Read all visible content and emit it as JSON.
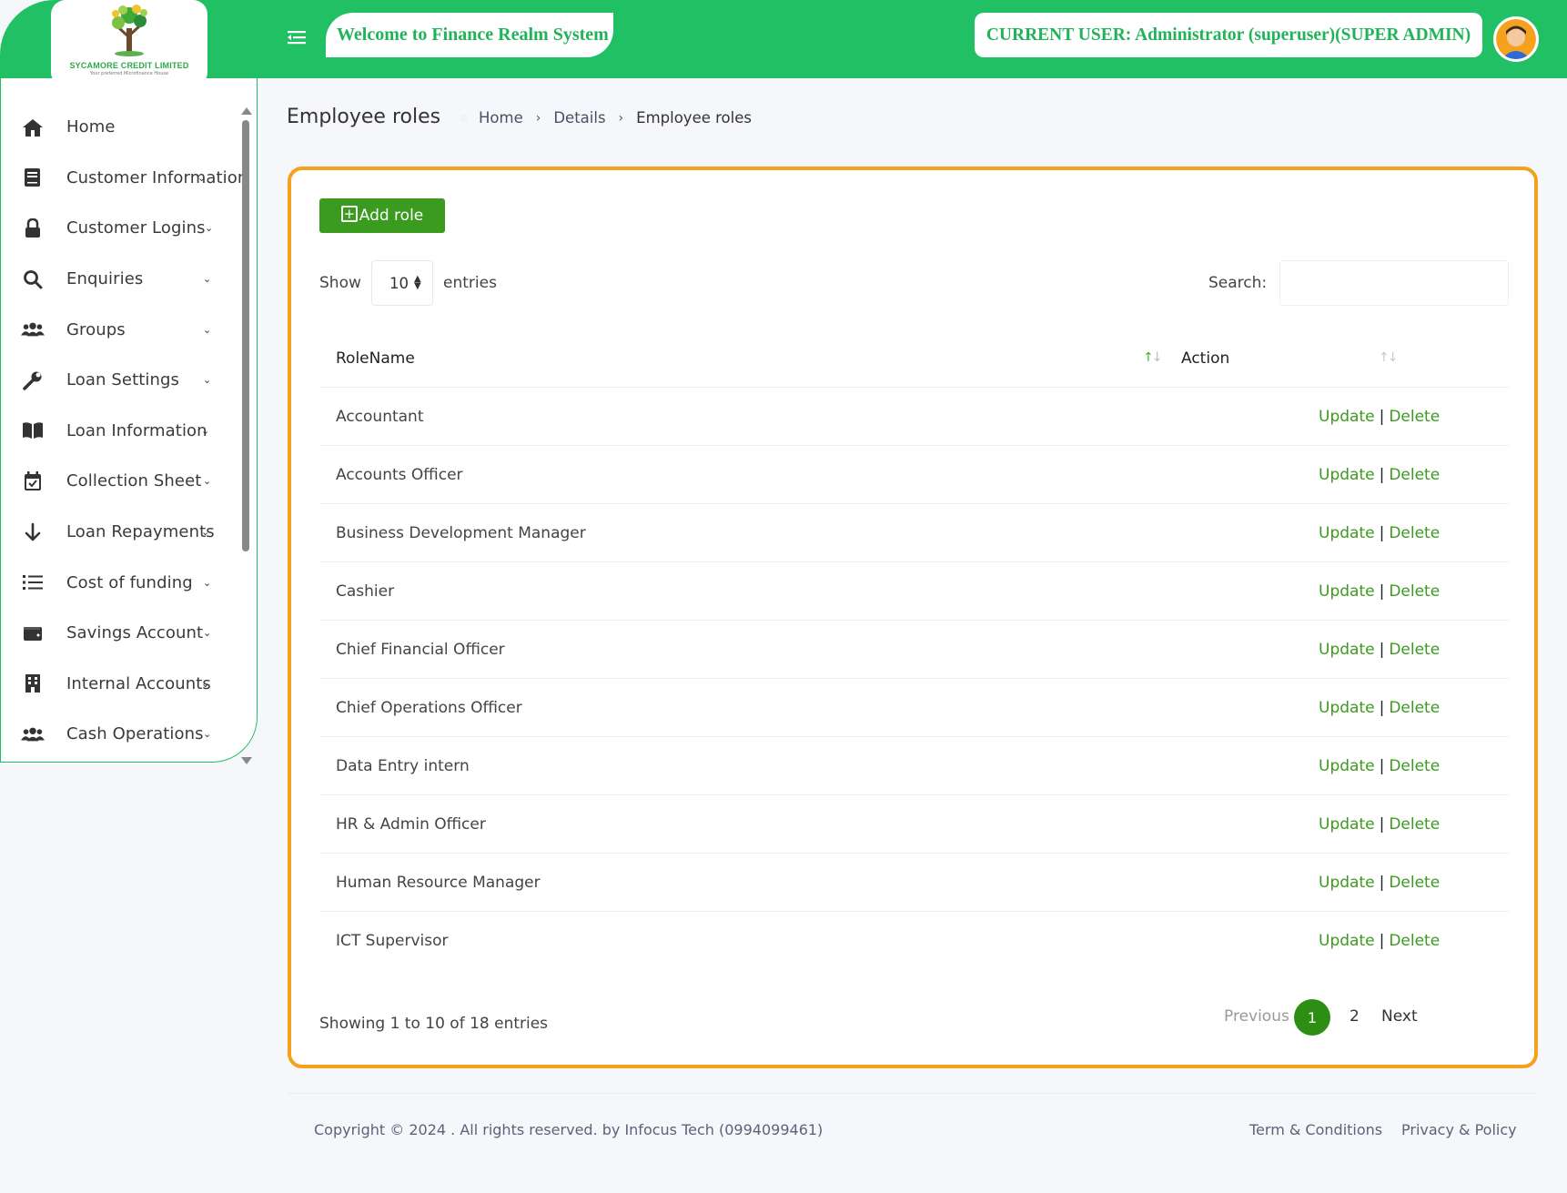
{
  "header": {
    "logo_name": "SYCAMORE CREDIT LIMITED",
    "logo_tagline": "Your preferred Microfinance House",
    "welcome_text": "Welcome to Finance Realm System",
    "current_user": "CURRENT USER: Administrator (superuser)(SUPER ADMIN)",
    "brand_color": "#22c064"
  },
  "sidebar": {
    "items": [
      {
        "label": "Home",
        "icon": "home-icon",
        "has_chevron": false
      },
      {
        "label": "Customer Information",
        "icon": "document-icon",
        "has_chevron": true
      },
      {
        "label": "Customer Logins",
        "icon": "lock-icon",
        "has_chevron": true
      },
      {
        "label": "Enquiries",
        "icon": "search-icon",
        "has_chevron": true
      },
      {
        "label": "Groups",
        "icon": "users-icon",
        "has_chevron": true
      },
      {
        "label": "Loan Settings",
        "icon": "wrench-icon",
        "has_chevron": true
      },
      {
        "label": "Loan Information",
        "icon": "book-icon",
        "has_chevron": true
      },
      {
        "label": "Collection Sheet",
        "icon": "calendar-check-icon",
        "has_chevron": true
      },
      {
        "label": "Loan Repayments",
        "icon": "arrow-down-icon",
        "has_chevron": true
      },
      {
        "label": "Cost of funding",
        "icon": "list-icon",
        "has_chevron": true
      },
      {
        "label": "Savings Account",
        "icon": "wallet-icon",
        "has_chevron": true
      },
      {
        "label": "Internal Accounts",
        "icon": "building-icon",
        "has_chevron": true
      },
      {
        "label": "Cash Operations",
        "icon": "users-icon",
        "has_chevron": true
      }
    ]
  },
  "page": {
    "title": "Employee roles",
    "breadcrumb": [
      "Home",
      "Details",
      "Employee roles"
    ]
  },
  "card": {
    "add_button": "Add role",
    "show_label": "Show",
    "entries_value": "10",
    "entries_label": "entries",
    "search_label": "Search:",
    "search_value": "",
    "columns": [
      "RoleName",
      "Action"
    ],
    "rows": [
      {
        "name": "Accountant",
        "update": "Update",
        "delete": "Delete"
      },
      {
        "name": "Accounts Officer",
        "update": "Update",
        "delete": "Delete"
      },
      {
        "name": "Business Development Manager",
        "update": "Update",
        "delete": "Delete"
      },
      {
        "name": "Cashier",
        "update": "Update",
        "delete": "Delete"
      },
      {
        "name": "Chief Financial Officer",
        "update": "Update",
        "delete": "Delete"
      },
      {
        "name": "Chief Operations Officer",
        "update": "Update",
        "delete": "Delete"
      },
      {
        "name": "Data Entry intern",
        "update": "Update",
        "delete": "Delete"
      },
      {
        "name": "HR & Admin Officer",
        "update": "Update",
        "delete": "Delete"
      },
      {
        "name": "Human Resource Manager",
        "update": "Update",
        "delete": "Delete"
      },
      {
        "name": "ICT Supervisor",
        "update": "Update",
        "delete": "Delete"
      }
    ],
    "action_separator": "|",
    "info": "Showing 1 to 10 of 18 entries",
    "pagination": {
      "previous": "Previous",
      "pages": [
        "1",
        "2"
      ],
      "current": "1",
      "next": "Next"
    },
    "accent_color": "#f4a21d",
    "action_color": "#3a9b1e"
  },
  "footer": {
    "copyright": "Copyright © 2024 . All rights reserved. by Infocus Tech (0994099461)",
    "terms": "Term & Conditions",
    "privacy": "Privacy & Policy"
  }
}
